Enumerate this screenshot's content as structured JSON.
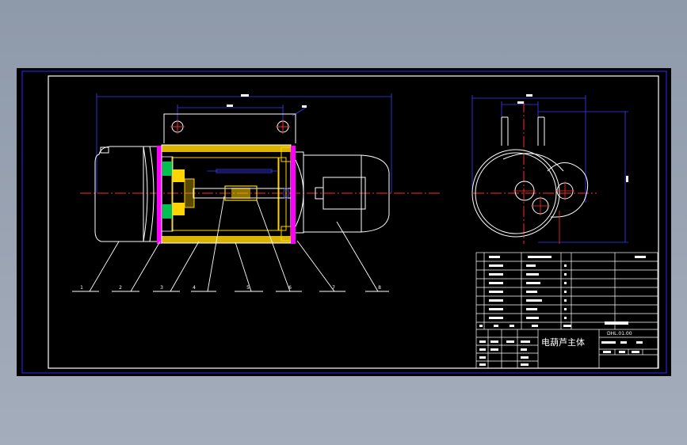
{
  "drawing": {
    "title": "电葫芦主体",
    "drawing_number": "DHL.01.00"
  },
  "leaders": [
    "1",
    "2",
    "3",
    "4",
    "5",
    "6",
    "7",
    "8"
  ],
  "colors": {
    "canvas": "#000000",
    "frame": "#2a2aff",
    "outline": "#ffffff",
    "center": "#ff2a2a",
    "dimension": "#3c3cff",
    "hatch": "#ffd400",
    "parts": "#00ff66",
    "magenta": "#ff00ff"
  }
}
